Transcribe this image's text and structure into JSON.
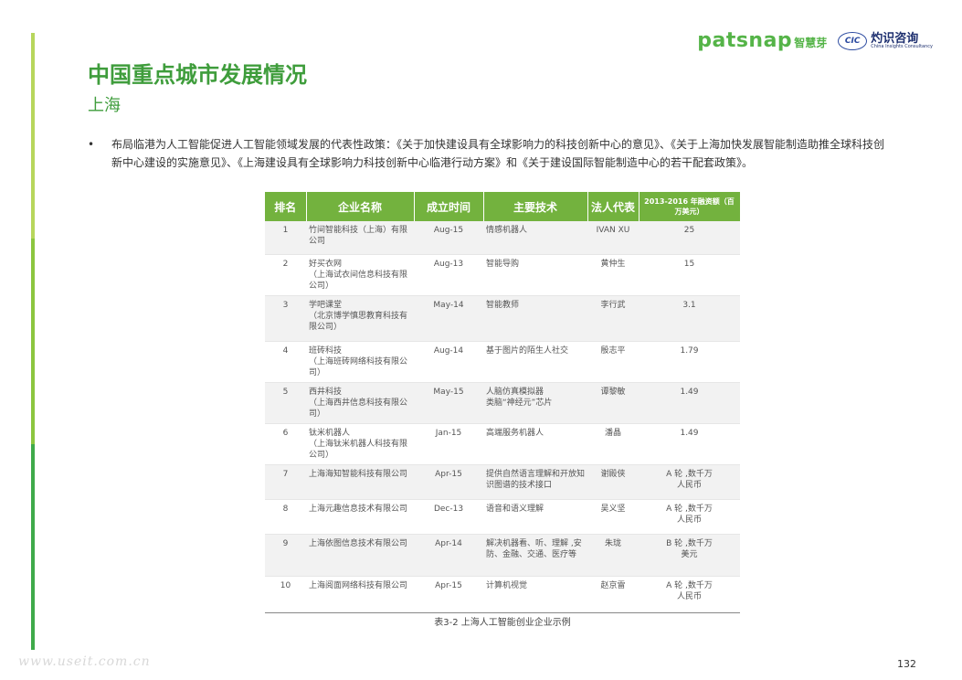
{
  "brand": {
    "patsnap": "patsnap",
    "patsnap_cn": "智慧芽",
    "cic_badge": "CIC",
    "cic_cn": "灼识咨询",
    "cic_en": "China Insights Consultancy"
  },
  "title": "中国重点城市发展情况",
  "subtitle": "上海",
  "policy": {
    "bullet": "•",
    "text": "布局临港为人工智能促进人工智能领域发展的代表性政策：《关于加快建设具有全球影响力的科技创新中心的意见》、《关于上海加快发展智能制造助推全球科技创新中心建设的实施意见》、《上海建设具有全球影响力科技创新中心临港行动方案》和《关于建设国际智能制造中心的若干配套政策》。"
  },
  "table": {
    "headers": [
      "排名",
      "企业名称",
      "成立时间",
      "主要技术",
      "法人代表",
      "2013-2016 年融资额（百万美元）"
    ],
    "rows": [
      {
        "rank": "1",
        "name": "竹间智能科技（上海）有限公司",
        "date": "Aug-15",
        "tech": "情感机器人",
        "rep": "IVAN XU",
        "amount": "25"
      },
      {
        "rank": "2",
        "name": "好买衣网\n（上海试衣间信息科技有限公司）",
        "date": "Aug-13",
        "tech": "智能导购",
        "rep": "黄仲生",
        "amount": "15"
      },
      {
        "rank": "3",
        "name": "学吧课堂\n（北京博学慎思教育科技有限公司）",
        "date": "May-14",
        "tech": "智能教师",
        "rep": "李行武",
        "amount": "3.1"
      },
      {
        "rank": "4",
        "name": "班砖科技\n（上海班砖网络科技有限公司）",
        "date": "Aug-14",
        "tech": "基于图片的陌生人社交",
        "rep": "殷志平",
        "amount": "1.79"
      },
      {
        "rank": "5",
        "name": "西井科技\n（上海西井信息科技有限公司）",
        "date": "May-15",
        "tech": "人脑仿真模拟器\n类脑“神经元”芯片",
        "rep": "谭黎敏",
        "amount": "1.49"
      },
      {
        "rank": "6",
        "name": "钛米机器人\n（上海钛米机器人科技有限公司）",
        "date": "Jan-15",
        "tech": "高端服务机器人",
        "rep": "潘晶",
        "amount": "1.49"
      },
      {
        "rank": "7",
        "name": "上海海知智能科技有限公司",
        "date": "Apr-15",
        "tech": "提供自然语言理解和开放知识图谱的技术接口",
        "rep": "谢殿侠",
        "amount": "A 轮 ,数千万\n人民币"
      },
      {
        "rank": "8",
        "name": "上海元趣信息技术有限公司",
        "date": "Dec-13",
        "tech": "语音和语义理解",
        "rep": "吴义坚",
        "amount": "A 轮 ,数千万\n人民币"
      },
      {
        "rank": "9",
        "name": "上海依图信息技术有限公司",
        "date": "Apr-14",
        "tech": "解决机器看、听、理解 ,安防、金融、交通、医疗等",
        "rep": "朱珑",
        "amount": "B 轮 ,数千万\n美元"
      },
      {
        "rank": "10",
        "name": "上海阅面网络科技有限公司",
        "date": "Apr-15",
        "tech": "计算机视觉",
        "rep": "赵京雷",
        "amount": "A 轮 ,数千万\n人民币"
      }
    ]
  },
  "caption": "表3-2 上海人工智能创业企业示例",
  "page_number": "132",
  "watermark": "www.useit.com.cn"
}
